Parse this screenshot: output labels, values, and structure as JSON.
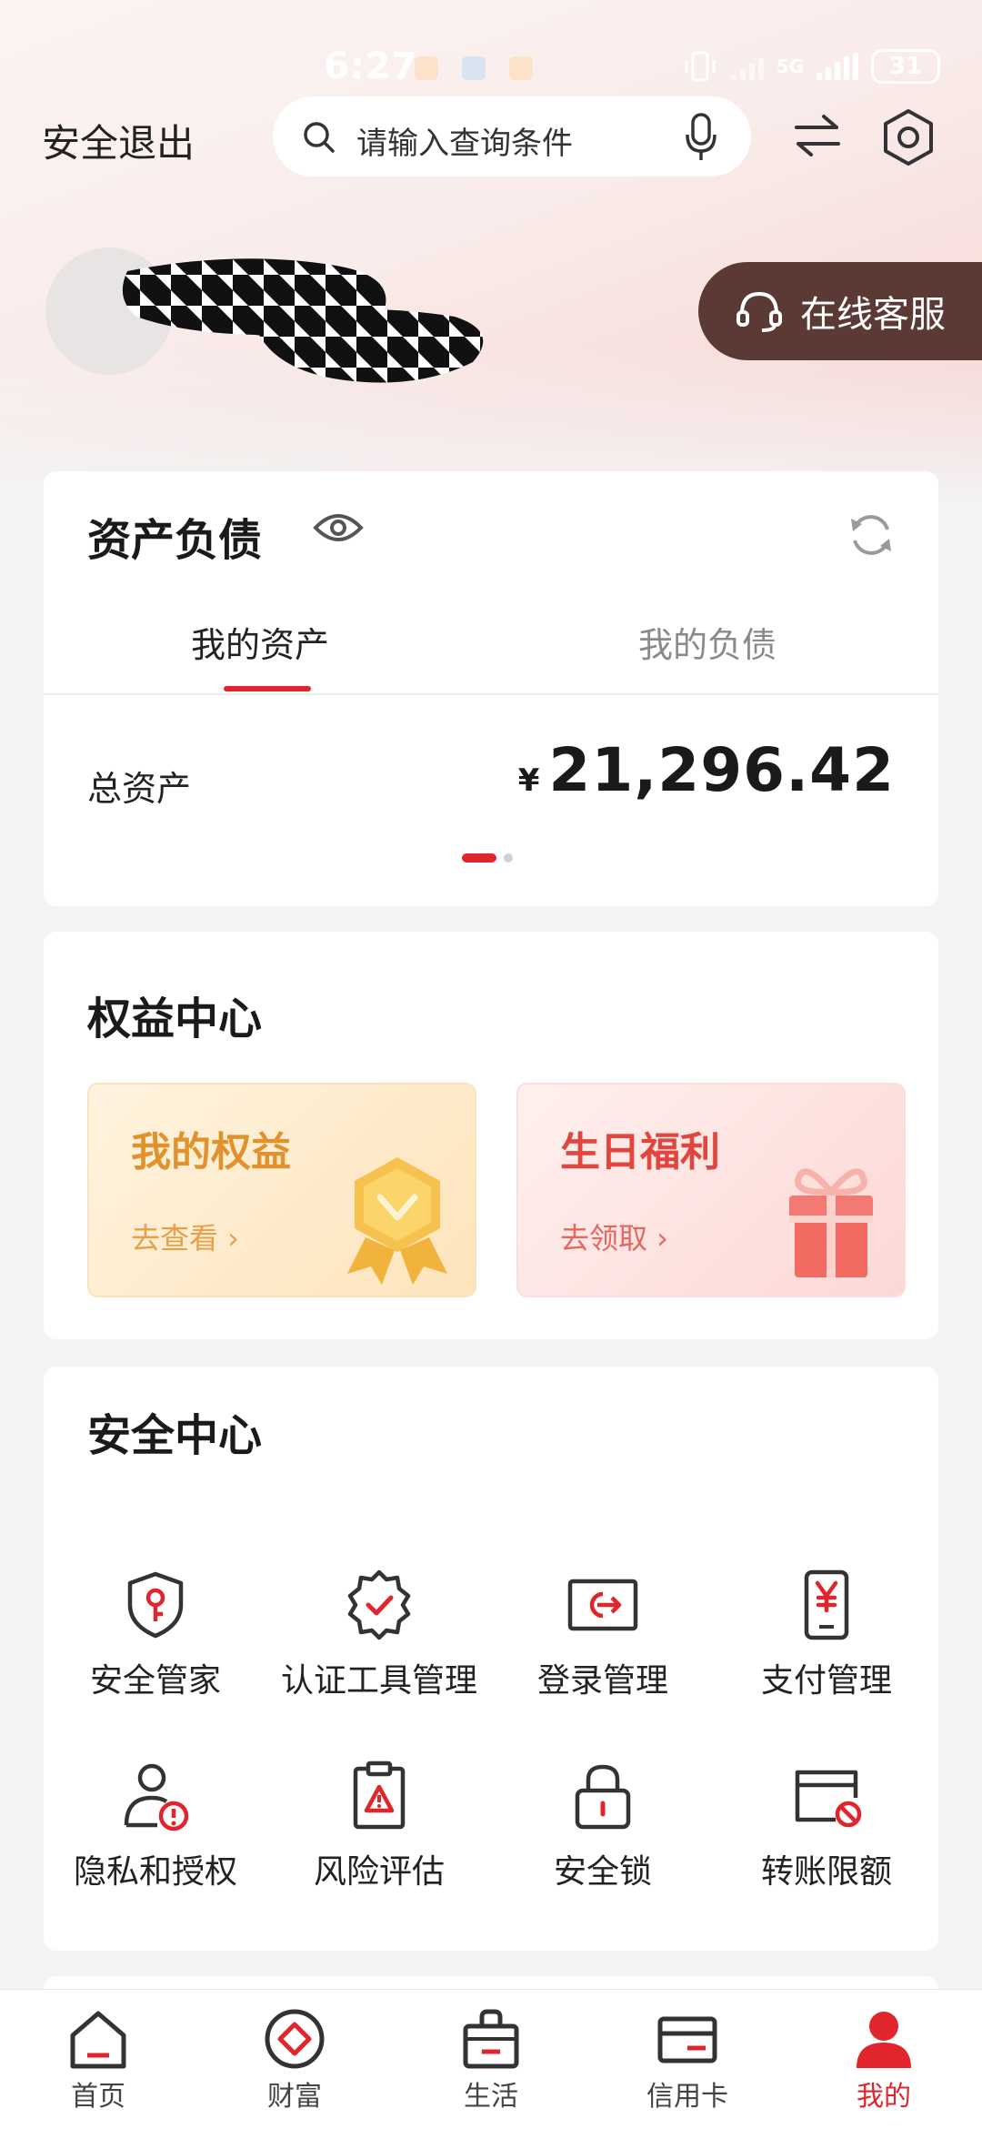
{
  "status_bar": {
    "time": "6:27",
    "network": "5G",
    "battery": "31"
  },
  "header": {
    "logout_label": "安全退出",
    "search_placeholder": "请输入查询条件",
    "icons": [
      "search-icon",
      "microphone-icon",
      "switch-arrows-icon",
      "settings-hexagon-icon"
    ]
  },
  "profile": {
    "service_label": "在线客服"
  },
  "assets": {
    "title": "资产负债",
    "tabs": [
      {
        "label": "我的资产",
        "active": true
      },
      {
        "label": "我的负债",
        "active": false
      }
    ],
    "total_label": "总资产",
    "currency": "¥",
    "total_value": "21,296.42",
    "page_count": 2,
    "page_index": 0
  },
  "benefits": {
    "title": "权益中心",
    "items": [
      {
        "title": "我的权益",
        "link": "去查看 ›"
      },
      {
        "title": "生日福利",
        "link": "去领取 ›"
      }
    ]
  },
  "security": {
    "title": "安全中心",
    "items": [
      {
        "label": "安全管家",
        "icon": "shield-key-icon"
      },
      {
        "label": "认证工具管理",
        "icon": "badge-check-icon"
      },
      {
        "label": "登录管理",
        "icon": "login-screen-icon"
      },
      {
        "label": "支付管理",
        "icon": "phone-yen-icon"
      },
      {
        "label": "隐私和授权",
        "icon": "user-alert-icon"
      },
      {
        "label": "风险评估",
        "icon": "clipboard-warning-icon"
      },
      {
        "label": "安全锁",
        "icon": "lock-icon"
      },
      {
        "label": "转账限额",
        "icon": "card-forbidden-icon"
      }
    ]
  },
  "bottom_nav": {
    "items": [
      {
        "label": "首页",
        "icon": "home-icon"
      },
      {
        "label": "财富",
        "icon": "wealth-icon"
      },
      {
        "label": "生活",
        "icon": "shopping-bag-icon"
      },
      {
        "label": "信用卡",
        "icon": "credit-card-icon"
      },
      {
        "label": "我的",
        "icon": "user-icon",
        "active": true
      }
    ]
  },
  "colors": {
    "accent": "#e0262c",
    "service_button": "#5b3a36",
    "benefit_gold": "#e2922c",
    "benefit_red": "#e2453d"
  }
}
